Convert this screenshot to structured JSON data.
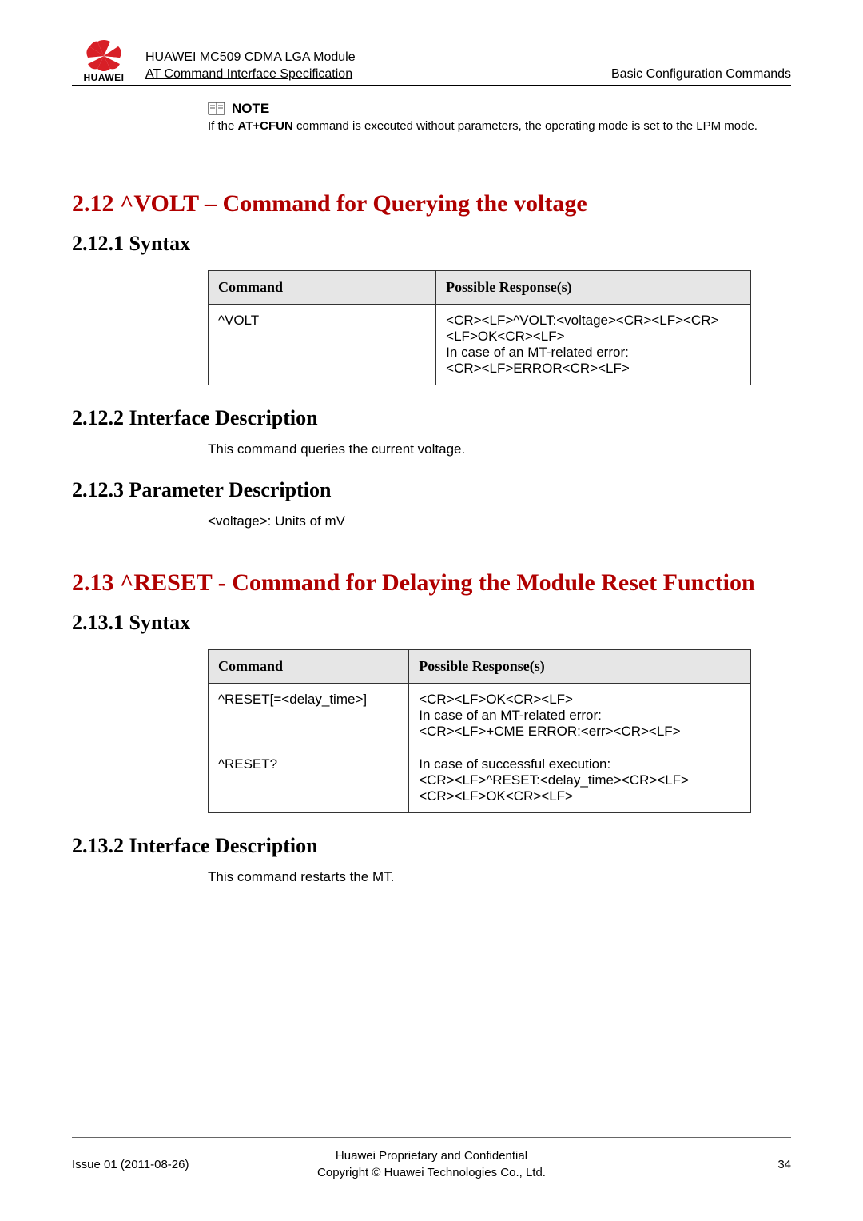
{
  "header": {
    "logo_text": "HUAWEI",
    "line1": "HUAWEI MC509 CDMA LGA Module",
    "line2": "AT Command Interface Specification",
    "right": "Basic Configuration Commands"
  },
  "note": {
    "icon": "book-icon",
    "title": "NOTE",
    "text_parts": [
      "If the ",
      "AT+CFUN",
      " command is executed without parameters, the operating mode is set to the LPM mode."
    ]
  },
  "section_212": {
    "heading": "2.12 ^VOLT – Command for Querying the voltage",
    "syntax_heading": "2.12.1 Syntax",
    "table": {
      "headers": [
        "Command",
        "Possible Response(s)"
      ],
      "rows": [
        [
          "^VOLT",
          "<CR><LF>^VOLT:<voltage><CR><LF><CR><LF>OK<CR><LF>\nIn case of an MT-related error:\n<CR><LF>ERROR<CR><LF>"
        ]
      ]
    },
    "iface_heading": "2.12.2 Interface Description",
    "iface_text": "This command queries the current voltage.",
    "param_heading": "2.12.3 Parameter Description",
    "param_text": "<voltage>: Units of mV"
  },
  "section_213": {
    "heading": "2.13 ^RESET - Command for Delaying the Module Reset Function",
    "syntax_heading": "2.13.1 Syntax",
    "table": {
      "headers": [
        "Command",
        "Possible Response(s)"
      ],
      "rows": [
        [
          "^RESET[=<delay_time>]",
          "<CR><LF>OK<CR><LF>\nIn case of an MT-related error:\n<CR><LF>+CME ERROR:<err><CR><LF>"
        ],
        [
          "^RESET?",
          "In case of successful execution:\n<CR><LF>^RESET:<delay_time><CR><LF>\n<CR><LF>OK<CR><LF>"
        ]
      ]
    },
    "iface_heading": "2.13.2 Interface Description",
    "iface_text": "This command restarts the MT."
  },
  "footer": {
    "left": "Issue 01 (2011-08-26)",
    "center_line1": "Huawei Proprietary and Confidential",
    "center_line2": "Copyright © Huawei Technologies Co., Ltd.",
    "right": "34"
  }
}
